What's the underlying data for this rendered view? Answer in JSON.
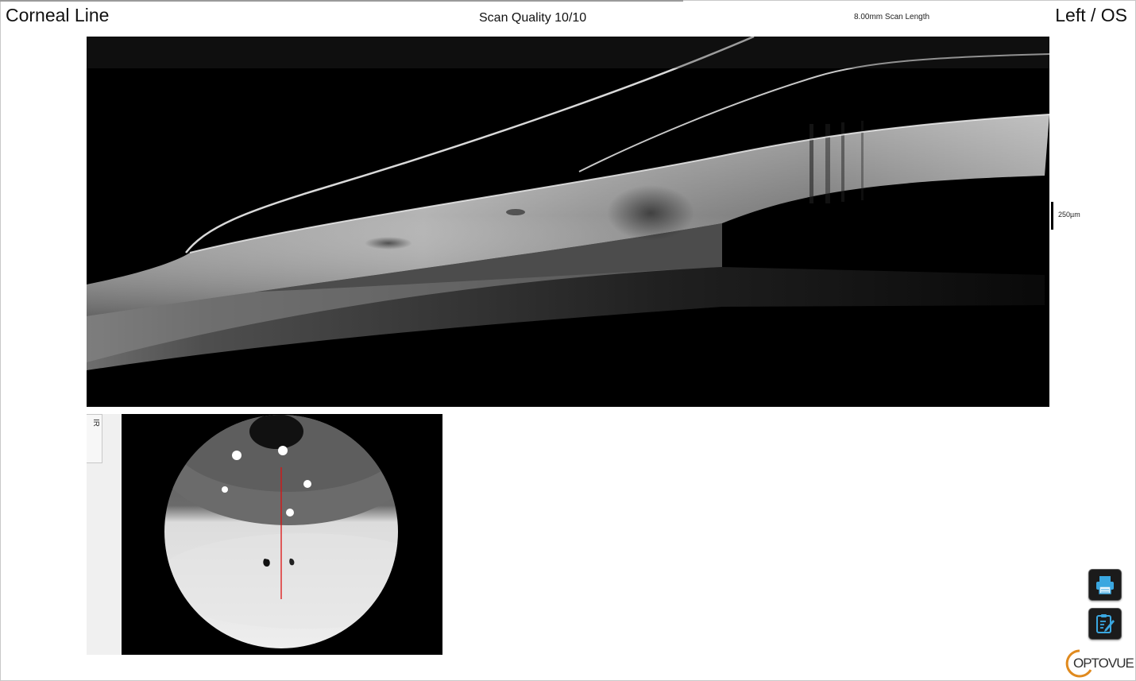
{
  "header": {
    "title": "Corneal Line",
    "scan_quality": "Scan Quality 10/10",
    "scan_length": "8.00mm Scan Length",
    "eye": "Left / OS"
  },
  "bscan": {
    "scale_label": "250µm"
  },
  "ir_panel": {
    "tab_label": "IR"
  },
  "toolbar": {
    "print_icon": "printer-icon",
    "report_icon": "clipboard-edit-icon",
    "accent": "#1e90c8"
  },
  "brand": {
    "logo_text": "OPTOVUE",
    "logo_accent": "#e08a1e"
  }
}
